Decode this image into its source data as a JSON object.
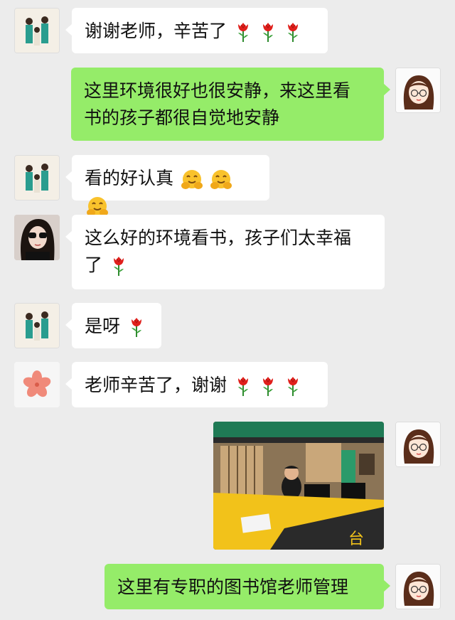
{
  "messages": [
    {
      "side": "in",
      "avatar": "family",
      "text": "谢谢老师，辛苦了",
      "emoji": [
        "rose",
        "rose",
        "rose"
      ]
    },
    {
      "side": "out",
      "avatar": "girl",
      "text_lines": [
        "这里环境很好也很安静，来这里看",
        "书的孩子都很自觉地安静"
      ]
    },
    {
      "side": "in",
      "avatar": "family",
      "text": "看的好认真",
      "emoji": [
        "hug",
        "hug",
        "hug"
      ]
    },
    {
      "side": "in",
      "avatar": "sunglasses",
      "text_lines": [
        "这么好的环境看书，孩子们太幸福",
        "了"
      ],
      "emoji": [
        "rose"
      ]
    },
    {
      "side": "in",
      "avatar": "family",
      "text": "是呀",
      "emoji": [
        "rose"
      ]
    },
    {
      "side": "in",
      "avatar": "flower",
      "text": "老师辛苦了，谢谢",
      "emoji": [
        "rose",
        "rose",
        "rose"
      ]
    },
    {
      "side": "out",
      "avatar": "girl",
      "type": "image",
      "image_desc": "library-front-desk"
    },
    {
      "side": "out",
      "avatar": "girl",
      "text": "这里有专职的图书馆老师管理"
    }
  ],
  "colors": {
    "background": "#ececec",
    "incoming": "#ffffff",
    "outgoing": "#95ec69"
  }
}
